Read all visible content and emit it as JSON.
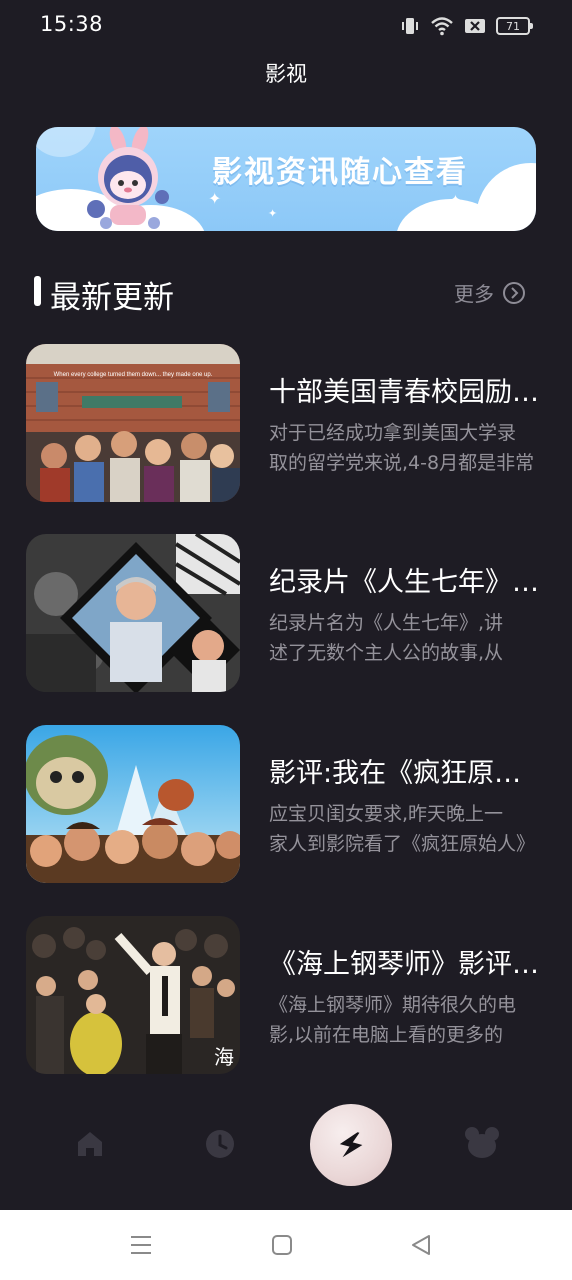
{
  "status_bar": {
    "time": "15:38",
    "battery_level": "71",
    "icons": [
      "vibrate-icon",
      "wifi-icon",
      "sim-off-icon",
      "battery-icon"
    ]
  },
  "header": {
    "title": "影视"
  },
  "banner": {
    "text": "影视资讯随心查看"
  },
  "section": {
    "title": "最新更新",
    "more_label": "更多"
  },
  "articles": [
    {
      "title": "十部美国青春校园励志电影",
      "desc_line1": "对于已经成功拿到美国大学录",
      "desc_line2": "取的留学党来说,4-8月都是非常",
      "thumb_caption": "When every college turned them down... they made one up."
    },
    {
      "title": "纪录片《人生七年》观后感",
      "desc_line1": "纪录片名为《人生七年》,讲",
      "desc_line2": "述了无数个主人公的故事,从"
    },
    {
      "title": "影评:我在《疯狂原始人》",
      "desc_line1": "应宝贝闺女要求,昨天晚上一",
      "desc_line2": "家人到影院看了《疯狂原始人》"
    },
    {
      "title": "《海上钢琴师》影评感想",
      "desc_line1": "《海上钢琴师》期待很久的电",
      "desc_line2": "影,以前在电脑上看的更多的",
      "thumb_caption": "海"
    }
  ],
  "tabbar": {
    "items": [
      "home-icon",
      "clock-icon",
      "lightning-icon",
      "bear-icon"
    ],
    "active": "lightning-icon"
  },
  "colors": {
    "background": "#1e1c24",
    "secondary_text": "#94929a",
    "banner": "#9fd4fb",
    "tab_inactive": "#3a3842"
  }
}
